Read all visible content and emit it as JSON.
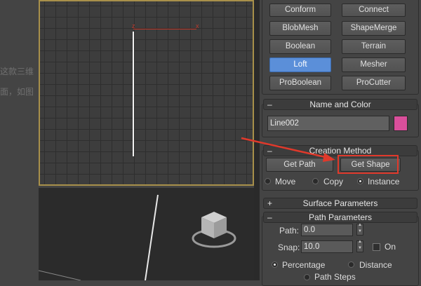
{
  "background_text": [
    "这款三维",
    "面，如图"
  ],
  "viewport_top": {
    "axis_z": "z",
    "axis_x": "x"
  },
  "compound_buttons": {
    "row0": [
      "Conform",
      "Connect"
    ],
    "row1": [
      "BlobMesh",
      "ShapeMerge"
    ],
    "row2": [
      "Boolean",
      "Terrain"
    ],
    "row3": [
      "Loft",
      "Mesher"
    ],
    "row4": [
      "ProBoolean",
      "ProCutter"
    ]
  },
  "name_color": {
    "header": "Name and Color",
    "toggle": "–",
    "name_value": "Line002",
    "color_swatch": "#d94f9b"
  },
  "creation_method": {
    "header": "Creation Method",
    "toggle": "–",
    "get_path": "Get Path",
    "get_shape": "Get Shape",
    "options": [
      "Move",
      "Copy",
      "Instance"
    ],
    "selected": "Instance"
  },
  "surface_parameters": {
    "header": "Surface Parameters",
    "toggle": "+"
  },
  "path_parameters": {
    "header": "Path Parameters",
    "toggle": "–",
    "path_label": "Path:",
    "path_value": "0.0",
    "snap_label": "Snap:",
    "snap_value": "10.0",
    "on_label": "On",
    "percentage_label": "Percentage",
    "distance_label": "Distance",
    "path_steps_label": "Path Steps"
  },
  "colors": {
    "accent_active": "#5b8fd9",
    "highlight_box": "#e0392b",
    "arrow": "#e0392b"
  }
}
